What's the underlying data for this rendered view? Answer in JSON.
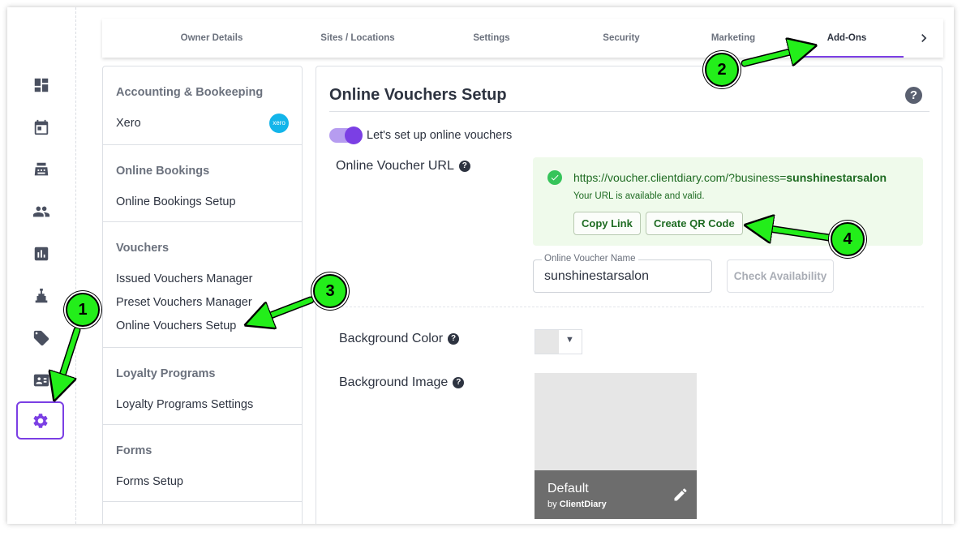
{
  "tabs": [
    {
      "label": "Owner Details"
    },
    {
      "label": "Sites / Locations"
    },
    {
      "label": "Settings"
    },
    {
      "label": "Security"
    },
    {
      "label": "Marketing"
    },
    {
      "label": "Add-Ons",
      "active": true
    }
  ],
  "rail": {
    "icons": [
      "dashboard-icon",
      "calendar-icon",
      "register-icon",
      "clients-icon",
      "reports-icon",
      "stock-icon",
      "tag-icon",
      "contact-card-icon",
      "gear-icon"
    ],
    "active": "gear-icon"
  },
  "menu": {
    "groups": [
      {
        "header": "Accounting & Bookeeping",
        "items": [
          {
            "label": "Xero",
            "badge": "xero"
          }
        ]
      },
      {
        "header": "Online Bookings",
        "items": [
          {
            "label": "Online Bookings Setup"
          }
        ]
      },
      {
        "header": "Vouchers",
        "items": [
          {
            "label": "Issued Vouchers Manager"
          },
          {
            "label": "Preset Vouchers Manager"
          },
          {
            "label": "Online Vouchers Setup"
          }
        ]
      },
      {
        "header": "Loyalty Programs",
        "items": [
          {
            "label": "Loyalty Programs Settings"
          }
        ]
      },
      {
        "header": "Forms",
        "items": [
          {
            "label": "Forms Setup"
          }
        ]
      }
    ]
  },
  "panel": {
    "title": "Online Vouchers Setup",
    "help": "?",
    "toggle_label": "Let's set up online vouchers",
    "toggle_on": true,
    "url_label": "Online Voucher URL",
    "url_prefix": "https://voucher.clientdiary.com/?business=",
    "url_business": "sunshinestarsalon",
    "url_status": "Your URL is available and valid.",
    "copy_link": "Copy Link",
    "create_qr": "Create QR Code",
    "name_label": "Online Voucher Name",
    "name_value": "sunshinestarsalon",
    "check_availability": "Check Availability",
    "bg_color_label": "Background Color",
    "bg_image_label": "Background Image",
    "bg_default": "Default",
    "bg_by": "by",
    "bg_brand": "ClientDiary"
  },
  "callouts": [
    "1",
    "2",
    "3",
    "4"
  ],
  "colors": {
    "accent": "#7b3fe4",
    "success": "#1e6b22",
    "callout": "#23ee1a"
  }
}
